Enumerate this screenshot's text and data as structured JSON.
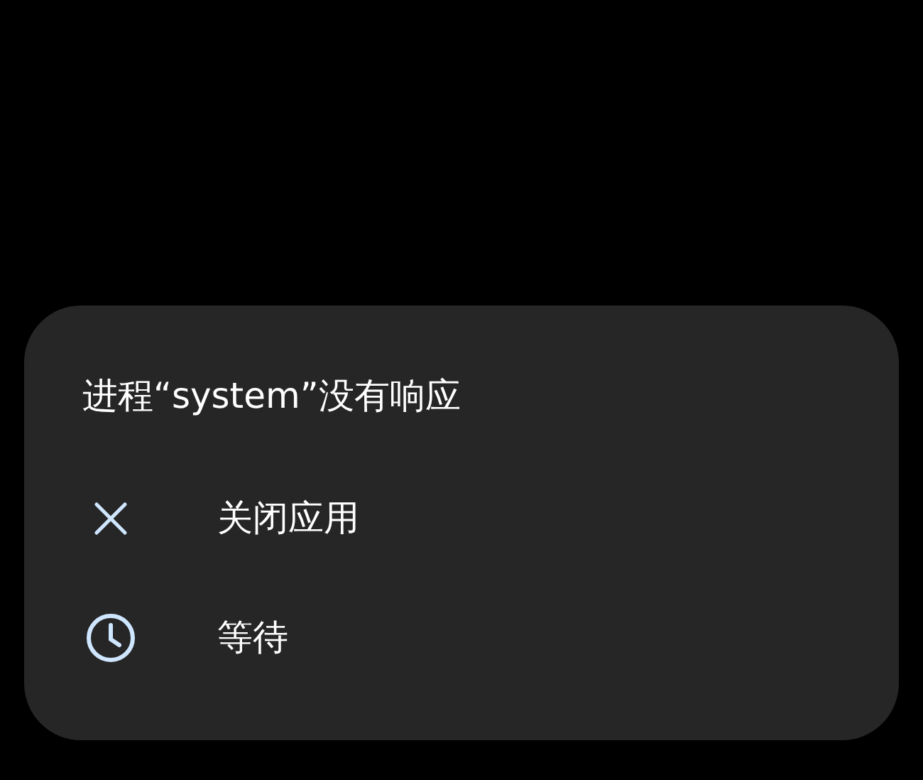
{
  "dialog": {
    "title": "进程“system”没有响应",
    "options": [
      {
        "kind": "close",
        "label": "关闭应用"
      },
      {
        "kind": "wait",
        "label": "等待"
      }
    ]
  }
}
